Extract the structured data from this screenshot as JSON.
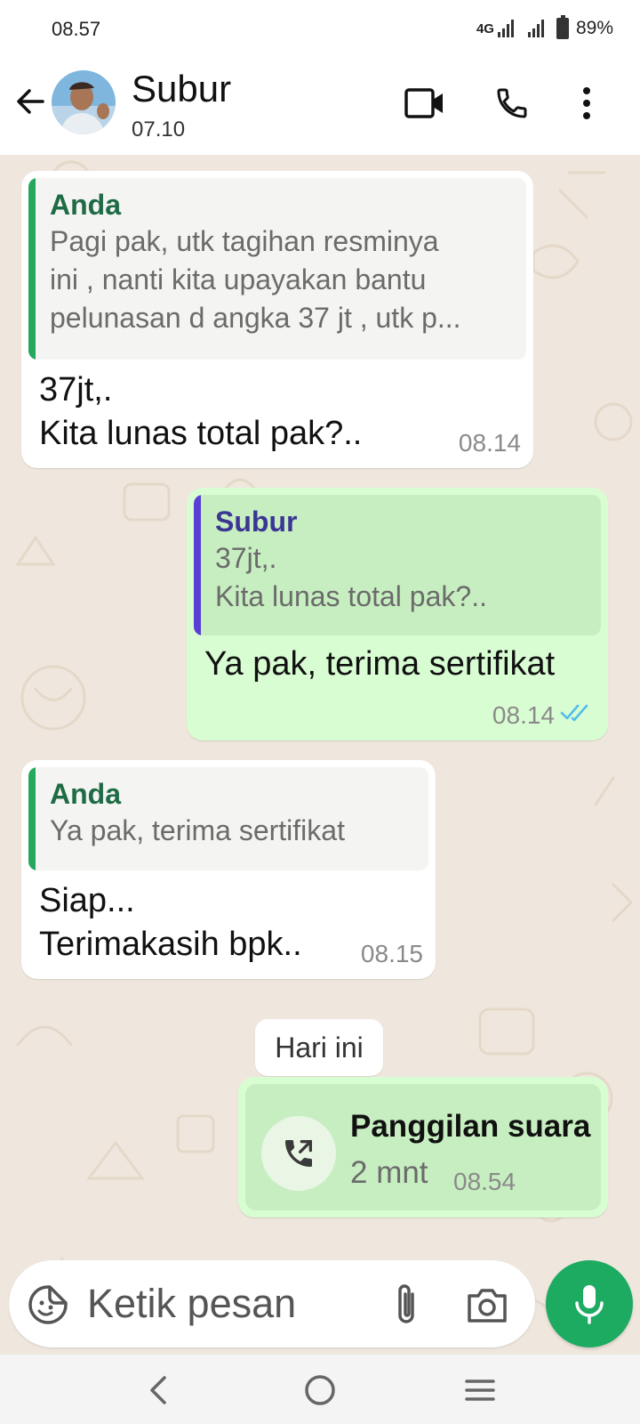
{
  "status_bar": {
    "time": "08.57",
    "network": "4G",
    "battery": "89%"
  },
  "header": {
    "contact_name": "Subur",
    "subtitle": "07.10"
  },
  "messages": [
    {
      "direction": "incoming",
      "quote": {
        "author": "Anda",
        "lines": [
          "Pagi pak, utk tagihan resminya",
          "ini , nanti kita upayakan bantu",
          "pelunasan d angka 37 jt , utk p..."
        ]
      },
      "text": "37jt,.\nKita lunas total pak?..",
      "time": "08.14"
    },
    {
      "direction": "outgoing",
      "quote": {
        "author": "Subur",
        "lines": [
          "37jt,.",
          "Kita lunas total pak?.."
        ]
      },
      "text": "Ya pak, terima sertifikat",
      "time": "08.14",
      "status": "read"
    },
    {
      "direction": "incoming",
      "quote": {
        "author": "Anda",
        "lines": [
          "Ya pak, terima sertifikat"
        ]
      },
      "text": "Siap...\nTerimakasih bpk..",
      "time": "08.15"
    }
  ],
  "date_separator": "Hari ini",
  "call_message": {
    "title": "Panggilan suara",
    "duration": "2 mnt",
    "time": "08.54"
  },
  "composer": {
    "placeholder": "Ketik pesan"
  },
  "colors": {
    "chat_background": "#efe7dd",
    "outgoing_bubble": "#d9fdd3",
    "incoming_bubble": "#ffffff",
    "quote_author_self": "#1f6b45",
    "quote_author_contact": "#3b3594",
    "quote_bar_self": "#25a85e",
    "quote_bar_contact": "#5a3fd6",
    "read_ticks": "#53bdeb",
    "mic_button": "#1daa61"
  },
  "icons": {
    "back": "arrow-left-icon",
    "video": "video-camera-icon",
    "call": "phone-icon",
    "menu": "more-vertical-icon",
    "emoji": "sticker-icon",
    "attach": "paperclip-icon",
    "camera": "camera-icon",
    "mic": "microphone-icon",
    "outgoing_call": "outgoing-call-icon"
  }
}
